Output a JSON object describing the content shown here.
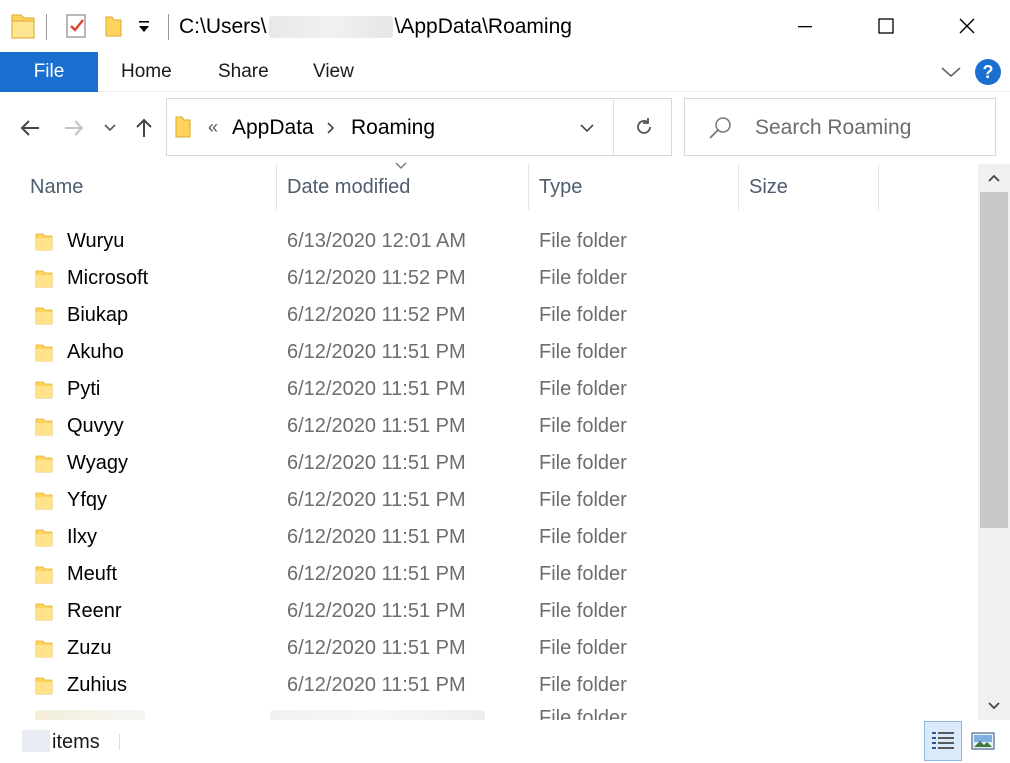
{
  "window": {
    "title_prefix": "C:\\Users\\",
    "title_suffix": "\\AppData\\Roaming",
    "controls": {
      "minimize": "─",
      "maximize": "☐",
      "close": "✕"
    }
  },
  "ribbon": {
    "tabs": [
      "File",
      "Home",
      "Share",
      "View"
    ],
    "help": "?"
  },
  "address_bar": {
    "overflow": "«",
    "breadcrumbs": [
      "AppData",
      "Roaming"
    ]
  },
  "search": {
    "placeholder": "Search Roaming"
  },
  "columns": [
    "Name",
    "Date modified",
    "Type",
    "Size"
  ],
  "files": [
    {
      "name": "Wuryu",
      "date": "6/13/2020 12:01 AM",
      "type": "File folder"
    },
    {
      "name": "Microsoft",
      "date": "6/12/2020 11:52 PM",
      "type": "File folder"
    },
    {
      "name": "Biukap",
      "date": "6/12/2020 11:52 PM",
      "type": "File folder"
    },
    {
      "name": "Akuho",
      "date": "6/12/2020 11:51 PM",
      "type": "File folder"
    },
    {
      "name": "Pyti",
      "date": "6/12/2020 11:51 PM",
      "type": "File folder"
    },
    {
      "name": "Quvyy",
      "date": "6/12/2020 11:51 PM",
      "type": "File folder"
    },
    {
      "name": "Wyagy",
      "date": "6/12/2020 11:51 PM",
      "type": "File folder"
    },
    {
      "name": "Yfqy",
      "date": "6/12/2020 11:51 PM",
      "type": "File folder"
    },
    {
      "name": "Ilxy",
      "date": "6/12/2020 11:51 PM",
      "type": "File folder"
    },
    {
      "name": "Meuft",
      "date": "6/12/2020 11:51 PM",
      "type": "File folder"
    },
    {
      "name": "Reenr",
      "date": "6/12/2020 11:51 PM",
      "type": "File folder"
    },
    {
      "name": "Zuzu",
      "date": "6/12/2020 11:51 PM",
      "type": "File folder"
    },
    {
      "name": "Zuhius",
      "date": "6/12/2020 11:51 PM",
      "type": "File folder"
    }
  ],
  "partial_row": {
    "type": "File folder"
  },
  "status_bar": {
    "items_label": "items"
  },
  "colors": {
    "accent": "#1a6fd1",
    "folder": "#ffd35c",
    "header_text": "#4d5d6e",
    "secondary_text": "#6d6d6d"
  }
}
